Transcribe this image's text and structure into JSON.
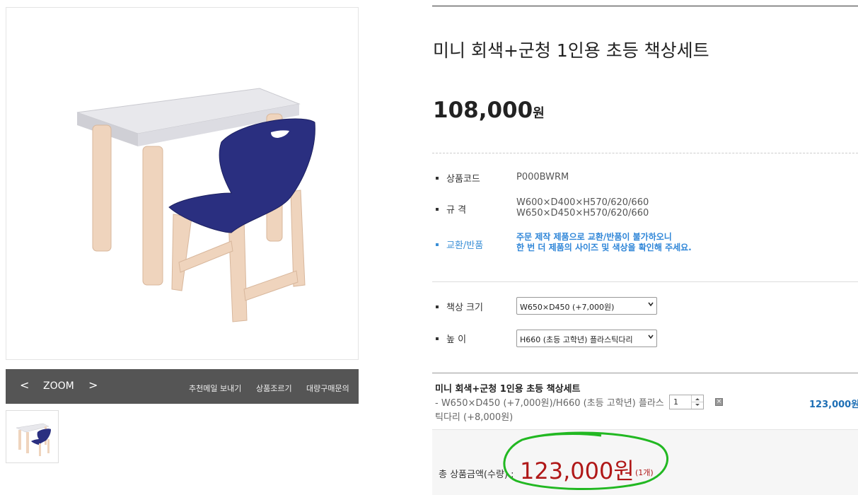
{
  "product": {
    "title": "미니 회색+군청 1인용 초등 책상세트",
    "price_number": "108,000",
    "price_unit": "원"
  },
  "gallery": {
    "prev_label": "<",
    "zoom_label": "ZOOM",
    "next_label": ">",
    "links": [
      "추천메일 보내기",
      "상품조르기",
      "대량구매문의"
    ]
  },
  "info": {
    "code_label": "상품코드",
    "code_value": "P000BWRM",
    "spec_label": "규 격",
    "spec_lines": [
      "W600×D400×H570/620/660",
      "W650×D450×H570/620/660"
    ],
    "return_label": "교환/반품",
    "return_lines": [
      "주문 제작 제품으로 교환/반품이 불가하오니",
      "한 번 더 제품의 사이즈 및 색상을 확인해 주세요."
    ]
  },
  "options": {
    "size_label": "책상 크기",
    "size_selected": "W650×D450 (+7,000원)",
    "height_label": "높 이",
    "height_selected": "H660 (초등 고학년) 플라스틱다리"
  },
  "selection": {
    "name": "미니 회색+군청 1인용 초등 책상세트",
    "option_text": "- W650×D450 (+7,000원)/H660 (초등 고학년) 플라스틱다리 (+8,000원)",
    "quantity": "1",
    "line_price": "123,000원"
  },
  "total": {
    "label": "총 상품금액(수량) :",
    "amount": "123,000원",
    "count": "(1개)"
  },
  "colors": {
    "accent_blue": "#2f86d8",
    "total_red": "#b01818",
    "annotation_green": "#22b822"
  }
}
